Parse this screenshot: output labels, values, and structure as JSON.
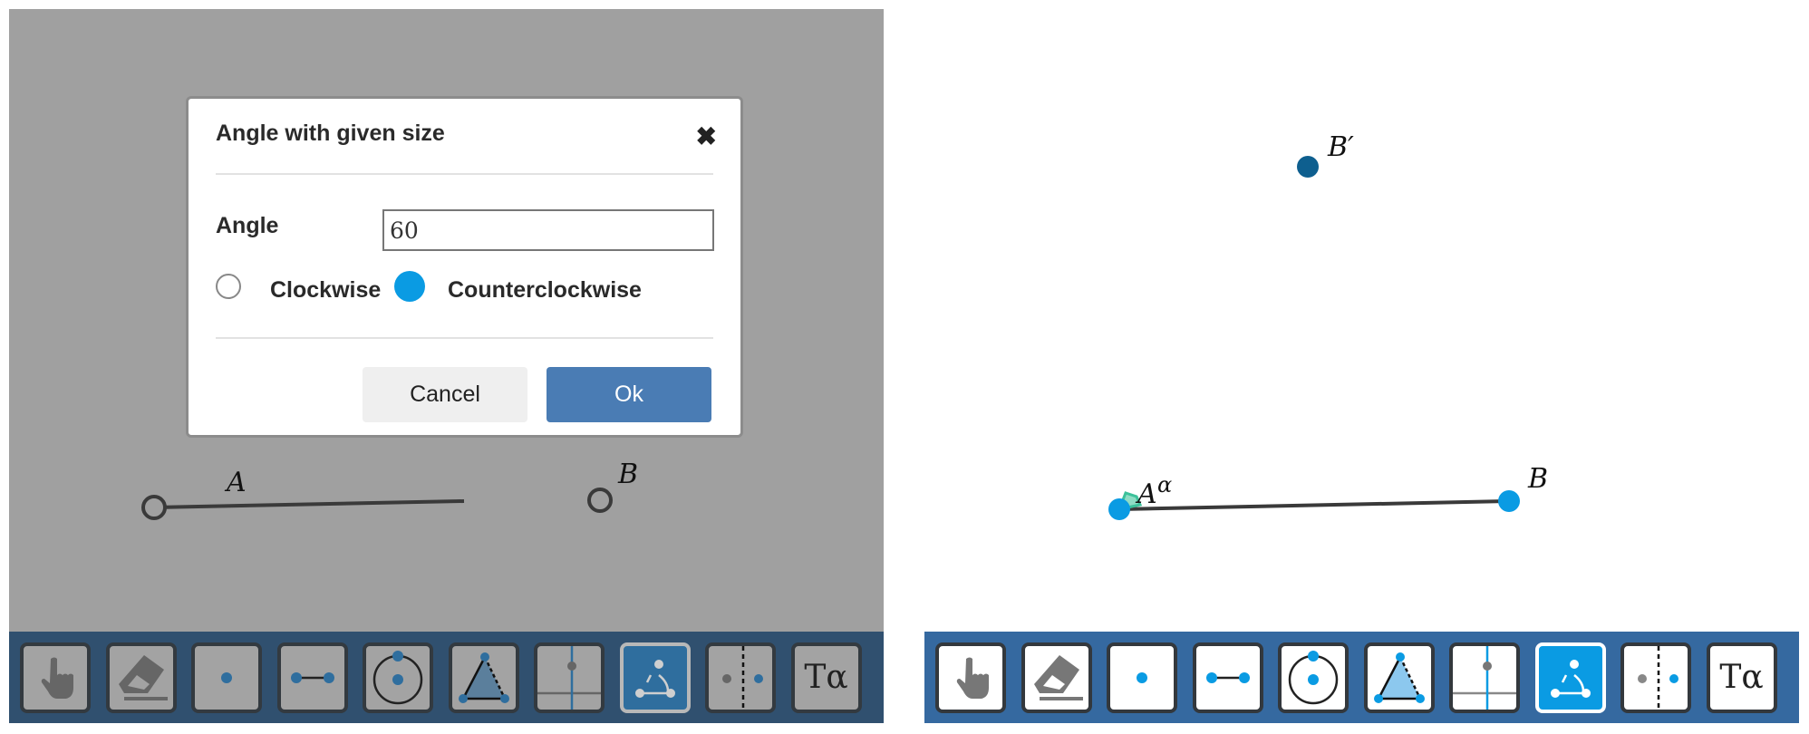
{
  "left_panel": {
    "dialog": {
      "title": "Angle with given size",
      "close_icon": "close-x-icon",
      "angle_label": "Angle",
      "angle_value": "60",
      "direction_options": [
        {
          "label": "Clockwise",
          "selected": false
        },
        {
          "label": "Counterclockwise",
          "selected": true
        }
      ],
      "cancel_label": "Cancel",
      "ok_label": "Ok"
    },
    "points": {
      "a_label": "A",
      "b_label": "B"
    }
  },
  "right_panel": {
    "points": {
      "a_label": "A",
      "a_angle_label": "α",
      "b_label": "B",
      "b_prime_label": "B′"
    }
  },
  "toolbar": {
    "tools": [
      {
        "name": "move",
        "icon": "hand-pointer-icon"
      },
      {
        "name": "delete",
        "icon": "eraser-icon"
      },
      {
        "name": "point",
        "icon": "point-icon"
      },
      {
        "name": "segment",
        "icon": "segment-icon"
      },
      {
        "name": "circle",
        "icon": "circle-icon"
      },
      {
        "name": "polygon",
        "icon": "triangle-icon"
      },
      {
        "name": "perpendicular",
        "icon": "perpendicular-icon"
      },
      {
        "name": "angle-with-given-size",
        "icon": "angle-icon",
        "active": true
      },
      {
        "name": "reflect",
        "icon": "reflect-icon"
      },
      {
        "name": "text",
        "icon": "text-icon",
        "label": "Tα"
      }
    ]
  },
  "colors": {
    "accent": "#0a9be3",
    "ok_button": "#4a7cb4",
    "toolbar_right": "#3569a0",
    "toolbar_left_dimmed": "#30506f",
    "overlay": "#a0a0a0",
    "point_b_prime": "#0e5f8f",
    "angle_marker": "#5ccfa8"
  }
}
